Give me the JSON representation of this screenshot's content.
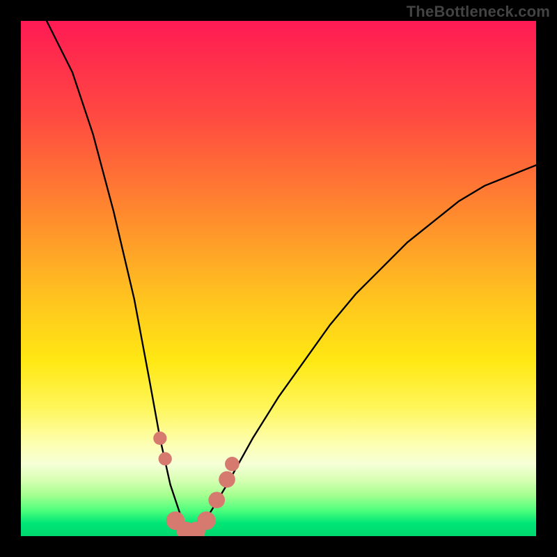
{
  "watermark": "TheBottleneck.com",
  "colors": {
    "page_background": "#000000",
    "watermark_text": "#434343",
    "curve_stroke": "#000000",
    "marker_fill": "#d67a6f",
    "gradient_stops": [
      "#ff1a55",
      "#ff2a4d",
      "#ff4842",
      "#ff7035",
      "#ff9a2a",
      "#ffc41f",
      "#ffe813",
      "#fff65a",
      "#fdffb0",
      "#f6ffd7",
      "#d9ffb5",
      "#a6ff90",
      "#4eff7d",
      "#00e676",
      "#00d86e"
    ]
  },
  "chart_data": {
    "type": "line",
    "title": "",
    "xlabel": "",
    "ylabel": "",
    "xlim": [
      0,
      100
    ],
    "ylim": [
      0,
      100
    ],
    "grid": false,
    "notes": "V-shaped bottleneck curve. Values on both axes are estimated percentages since no axes are drawn; y represents mismatch/bottleneck (high = red, low = green). Minimum lies near x≈33 (y≈0). Left arm is steep; right arm rises more gradually, reaching y≈72 at x=100. A cluster of salmon-colored markers sits along the curve near the trough (roughly x 27–41).",
    "series": [
      {
        "name": "bottleneck-curve",
        "x": [
          5,
          10,
          14,
          18,
          22,
          25,
          27,
          29,
          31,
          33,
          35,
          37,
          40,
          45,
          50,
          55,
          60,
          65,
          70,
          75,
          80,
          85,
          90,
          95,
          100
        ],
        "y": [
          100,
          90,
          78,
          63,
          46,
          30,
          19,
          10,
          4,
          0,
          2,
          5,
          10,
          19,
          27,
          34,
          41,
          47,
          52,
          57,
          61,
          65,
          68,
          70,
          72
        ]
      }
    ],
    "markers": [
      {
        "x": 27,
        "y": 19,
        "r": 1.3
      },
      {
        "x": 28,
        "y": 15,
        "r": 1.3
      },
      {
        "x": 30,
        "y": 3,
        "r": 1.8
      },
      {
        "x": 32,
        "y": 1,
        "r": 1.8
      },
      {
        "x": 34,
        "y": 1,
        "r": 1.8
      },
      {
        "x": 36,
        "y": 3,
        "r": 1.8
      },
      {
        "x": 38,
        "y": 7,
        "r": 1.6
      },
      {
        "x": 40,
        "y": 11,
        "r": 1.6
      },
      {
        "x": 41,
        "y": 14,
        "r": 1.4
      }
    ]
  }
}
